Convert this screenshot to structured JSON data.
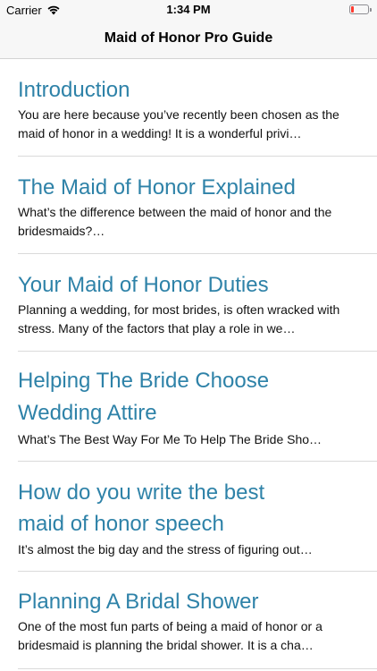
{
  "status_bar": {
    "carrier": "Carrier",
    "time": "1:34 PM",
    "battery_color": "#ff3b30"
  },
  "nav": {
    "title": "Maid of Honor Pro Guide"
  },
  "theme": {
    "title_color": "#2e82a8"
  },
  "articles": [
    {
      "title_lines": [
        "Introduction"
      ],
      "excerpt": "You are here because you’ve recently been chosen as the maid of honor in a wedding! It is a wonderful privi…"
    },
    {
      "title_lines": [
        "The Maid of Honor Explained"
      ],
      "excerpt": "What’s the difference between the maid of honor and the bridesmaids?…"
    },
    {
      "title_lines": [
        "Your Maid of Honor Duties"
      ],
      "excerpt": "Planning a wedding, for most brides, is often wracked with stress. Many of the factors that play a role in we…"
    },
    {
      "title_lines": [
        "Helping The Bride Choose",
        "Wedding Attire"
      ],
      "excerpt": "What’s The Best Way For Me To Help The Bride Sho…"
    },
    {
      "title_lines": [
        "How do you write the best",
        "maid of honor speech"
      ],
      "excerpt": "It’s almost the big day and the stress of figuring out…"
    },
    {
      "title_lines": [
        "Planning A Bridal Shower"
      ],
      "excerpt": "One of the most fun parts of being a maid of honor or a bridesmaid is planning the bridal shower. It is a cha…"
    }
  ]
}
